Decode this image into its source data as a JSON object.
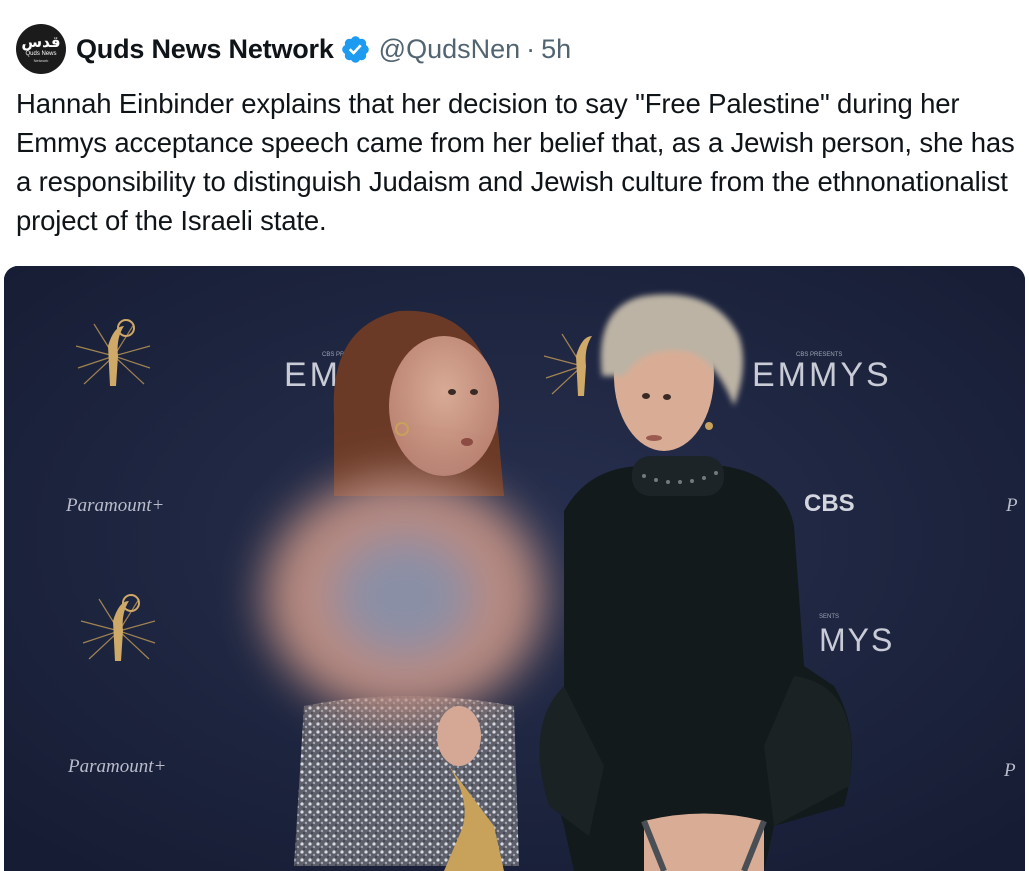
{
  "author": {
    "name": "Quds News Network",
    "handle": "@QudsNen",
    "separator": "·",
    "time": "5h",
    "avatar": {
      "script": "قدس",
      "line1": "Quds News",
      "line2": "Network"
    },
    "verified_icon": "verified-badge-icon",
    "verified_color": "#1d9bf0"
  },
  "tweet": {
    "text": "Hannah Einbinder explains that her decision to say \"Free Palestine\" during her Emmys acceptance speech came from her belief that, as a Jewish person, she has a responsibility to distinguish Judaism and Jewish culture from the ethnonationalist project of the Israeli state."
  },
  "media": {
    "backdrop_texts": {
      "emmy_left": "EMM",
      "emmy_right": "EMMYS",
      "emmy_lower": "MYS",
      "cbs": "CBS",
      "paramount_1": "Paramount+",
      "paramount_2": "Paramount+",
      "cbs_presents_1": "CBS PRESENTS",
      "cbs_presents_2": "CBS PRESENTS",
      "sents": "SENTS",
      "edge_1": "P",
      "edge_2": "P"
    },
    "colors": {
      "backdrop": "#1d2540",
      "gold": "#c8a15a",
      "text_silver": "#c9ccd6"
    }
  }
}
